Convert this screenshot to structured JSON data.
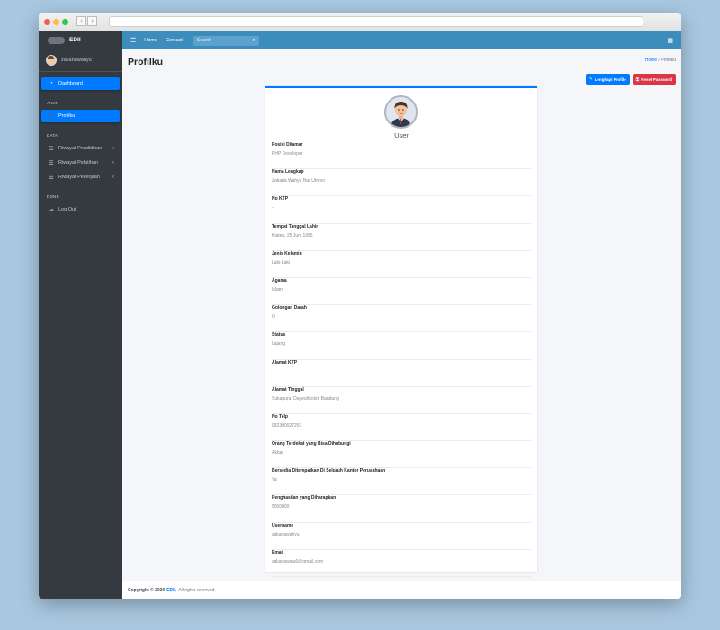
{
  "sidebar": {
    "brand": "EDII",
    "user_name": "zakariawahyu",
    "items": [
      {
        "type": "link",
        "label": "Dashboard",
        "icon": "dashboard-icon",
        "active": true
      },
      {
        "type": "header",
        "label": "AKUN"
      },
      {
        "type": "link",
        "label": "Profilku",
        "icon": "user-icon",
        "active": true
      },
      {
        "type": "header",
        "label": "DATA"
      },
      {
        "type": "link",
        "label": "Riwayat Pendidikan",
        "icon": "list-icon",
        "caret": true
      },
      {
        "type": "link",
        "label": "Riwayat Pelatihan",
        "icon": "list-icon",
        "caret": true
      },
      {
        "type": "link",
        "label": "Riwayat Pekerjaan",
        "icon": "list-icon",
        "caret": true
      },
      {
        "type": "header",
        "label": "DONE"
      },
      {
        "type": "link",
        "label": "Log Out",
        "icon": "logout-icon"
      }
    ]
  },
  "topbar": {
    "links": [
      "Home",
      "Contact"
    ],
    "search_placeholder": "Search"
  },
  "page": {
    "title": "Profilku",
    "breadcrumb": {
      "home": "Home",
      "separator": "/",
      "current": "Profilku"
    },
    "buttons": {
      "complete_profile": "Lengkapi Profile",
      "reset_password": "Reset Password"
    }
  },
  "profile": {
    "name": "User",
    "fields": [
      {
        "label": "Posisi Dilamar",
        "value": "PHP Developer"
      },
      {
        "label": "Nama Lengkap",
        "value": "Zakaria Wahyu Nur Utomo"
      },
      {
        "label": "No KTP",
        "value": "-"
      },
      {
        "label": "Tempat Tanggal Lahir",
        "value": "Klaten, 25 Juni 1995"
      },
      {
        "label": "Jenis Kelamin",
        "value": "Laki-Laki"
      },
      {
        "label": "Agama",
        "value": "Islam"
      },
      {
        "label": "Golongan Darah",
        "value": "O"
      },
      {
        "label": "Status",
        "value": "Lajang"
      },
      {
        "label": "Alamat KTP",
        "value": ""
      },
      {
        "label": "Alamat Tinggal",
        "value": "Sukapura, Dayeuhkolot, Bandung"
      },
      {
        "label": "No Telp",
        "value": "082300027297"
      },
      {
        "label": "Orang Terdekat yang Bisa Dihubungi",
        "value": "Akbar"
      },
      {
        "label": "Bersedia Ditempatkan Di Seluruh Kantor Perusahaan",
        "value": "Ya"
      },
      {
        "label": "Penghasilan yang Diharapkan",
        "value": "5000000"
      },
      {
        "label": "Username",
        "value": "zakariawahyu"
      },
      {
        "label": "Email",
        "value": "zakariawaju6@gmail.com"
      }
    ]
  },
  "footer": {
    "copyright": "Copyright © 2020",
    "brand": "EDII.",
    "rights": "All rights reserved."
  }
}
